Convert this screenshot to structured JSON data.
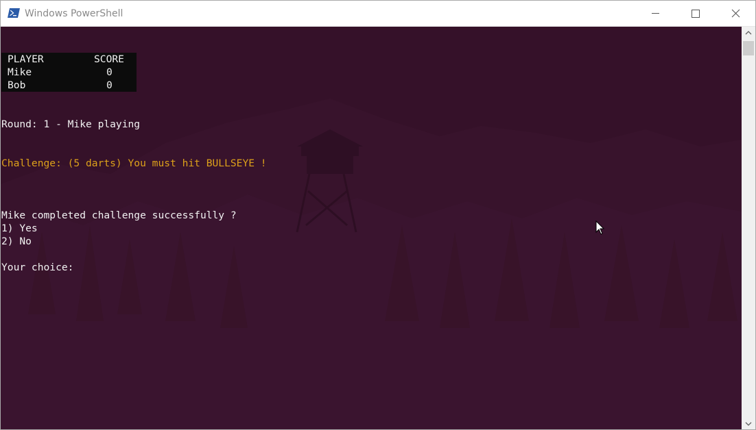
{
  "window": {
    "title": "Windows PowerShell",
    "icon": "powershell-icon",
    "controls": {
      "minimize": "minimize-icon",
      "maximize": "maximize-icon",
      "close": "close-icon"
    }
  },
  "colors": {
    "console_bg": "#351129",
    "text": "#f2f2f2",
    "challenge_text": "#dda11a",
    "table_bg": "#0c0c0c"
  },
  "scoreboard": {
    "header": {
      "player": "PLAYER",
      "score": "SCORE"
    },
    "rows": [
      {
        "player": "Mike",
        "score": "0"
      },
      {
        "player": "Bob",
        "score": "0"
      }
    ]
  },
  "console": {
    "round_line": "Round: 1 - Mike playing",
    "challenge_line": "Challenge: (5 darts) You must hit BULLSEYE !",
    "question_line": "Mike completed challenge successfully ?",
    "options": [
      "1) Yes",
      "2) No"
    ],
    "prompt": "Your choice:"
  }
}
